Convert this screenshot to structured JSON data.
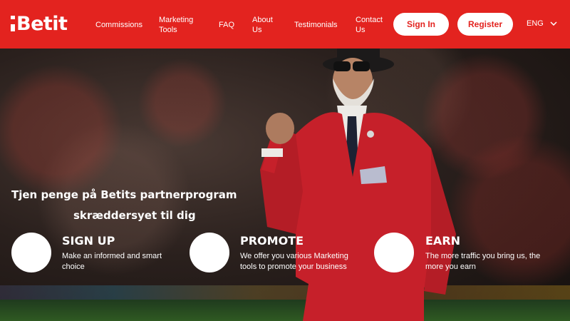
{
  "brand": {
    "name": "Betit"
  },
  "nav": {
    "commissions": "Commissions",
    "marketing_line1": "Marketing",
    "marketing_line2": "Tools",
    "faq": "FAQ",
    "about_line1": "About",
    "about_line2": "Us",
    "testimonials": "Testimonials",
    "contact_line1": "Contact",
    "contact_line2": "Us"
  },
  "auth": {
    "sign_in": "Sign In",
    "register": "Register"
  },
  "language": {
    "selected": "ENG"
  },
  "hero": {
    "headline_line1": "Tjen penge på Betits partnerprogram",
    "headline_line2": "skræddersyet til dig"
  },
  "features": [
    {
      "title": "SIGN UP",
      "desc_line1": "Make an informed and smart",
      "desc_line2": "choice"
    },
    {
      "title": "PROMOTE",
      "desc_line1": "We offer you various Marketing",
      "desc_line2": "tools to promote your business"
    },
    {
      "title": "EARN",
      "desc_line1": "The more traffic you bring us, the",
      "desc_line2": "more you earn"
    }
  ],
  "colors": {
    "brand_red": "#e3231f",
    "white": "#ffffff"
  },
  "icons": {
    "language_chevron": "chevron-down-icon"
  }
}
